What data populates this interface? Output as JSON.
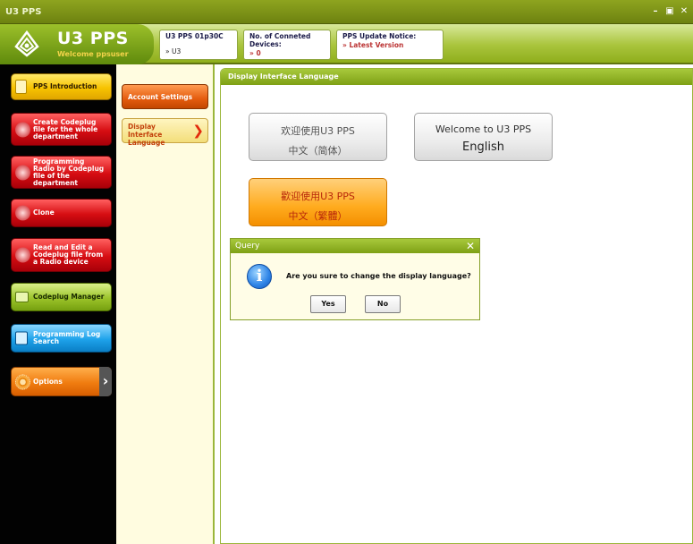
{
  "window": {
    "title": "U3 PPS",
    "controls": [
      "–",
      "▣",
      "✕"
    ]
  },
  "header": {
    "app_name": "U3 PPS",
    "welcome": "Welcome ppsuser",
    "version_label": "U3 PPS 01p30C",
    "version_value": "» U3",
    "devices_label": "No. of Conneted Devices:",
    "devices_value": "» 0",
    "update_label": "PPS Update Notice:",
    "update_value": "» Latest Version"
  },
  "leftnav": [
    {
      "label": "PPS Introduction",
      "style": "yellow"
    },
    {
      "label": "Create Codeplug file for the whole department",
      "style": "red"
    },
    {
      "label": "Programming Radio by Codeplug file of the department",
      "style": "red"
    },
    {
      "label": "Clone",
      "style": "red"
    },
    {
      "label": "Read and Edit a Codeplug file from a Radio device",
      "style": "red"
    },
    {
      "label": "Codeplug Manager",
      "style": "green"
    },
    {
      "label": "Programming Log Search",
      "style": "blue"
    },
    {
      "label": "Options",
      "style": "orange"
    }
  ],
  "subnav": {
    "account_settings": "Account Settings",
    "display_language": "Display Interface Language"
  },
  "main": {
    "title": "Display Interface Language",
    "lang_simplified": {
      "line1": "欢迎使用U3 PPS",
      "line2": "中文（简体）"
    },
    "lang_english": {
      "line1": "Welcome to U3 PPS",
      "line2": "English"
    },
    "lang_traditional": {
      "line1": "歡迎使用U3 PPS",
      "line2": "中文（繁體）"
    }
  },
  "dialog": {
    "title": "Query",
    "message": "Are you sure to change the display language?",
    "yes": "Yes",
    "no": "No"
  },
  "colors": {
    "header_green": "#8fae1c",
    "nav_red": "#d60d12",
    "accent_orange": "#f07c10",
    "sidebar_bg": "#020202"
  }
}
